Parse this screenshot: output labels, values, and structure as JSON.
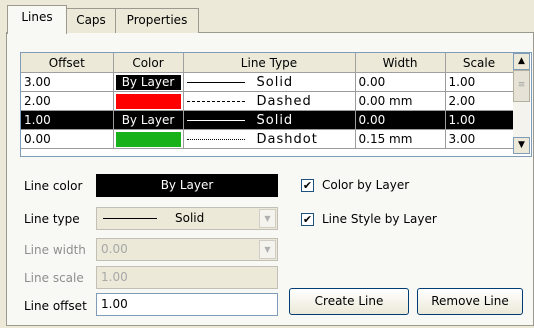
{
  "tabs": [
    "Lines",
    "Caps",
    "Properties"
  ],
  "grid": {
    "columns": [
      "Offset",
      "Color",
      "Line Type",
      "Width",
      "Scale"
    ],
    "rows": [
      {
        "offset": "3.00",
        "color_label": "By Layer",
        "color": "bylayer",
        "style": "solid",
        "line_type": "Solid",
        "width": "0.00",
        "scale": "1.00"
      },
      {
        "offset": "2.00",
        "color_label": "",
        "color": "#ff0000",
        "style": "dashed",
        "line_type": "Dashed",
        "width": "0.00 mm",
        "scale": "2.00"
      },
      {
        "offset": "1.00",
        "color_label": "By Layer",
        "color": "bylayer",
        "style": "solid",
        "line_type": "Solid",
        "width": "0.00",
        "scale": "1.00",
        "selected": true
      },
      {
        "offset": "0.00",
        "color_label": "",
        "color": "#19b119",
        "style": "dashdot",
        "line_type": "Dashdot",
        "width": "0.15 mm",
        "scale": "3.00"
      }
    ]
  },
  "form": {
    "line_color_label": "Line color",
    "line_color_value": "By Layer",
    "line_type_label": "Line type",
    "line_type_value": "Solid",
    "line_width_label": "Line width",
    "line_width_value": "0.00",
    "line_scale_label": "Line scale",
    "line_scale_value": "1.00",
    "line_offset_label": "Line offset",
    "line_offset_value": "1.00",
    "color_by_layer_label": "Color by Layer",
    "color_by_layer_checked": true,
    "style_by_layer_label": "Line Style by Layer",
    "style_by_layer_checked": true
  },
  "buttons": {
    "create": "Create Line",
    "remove": "Remove Line"
  },
  "icons": {
    "scroll_up": "arrow-up-icon",
    "scroll_down": "arrow-down-icon",
    "dropdown": "chevron-down-icon",
    "check": "check-icon"
  }
}
